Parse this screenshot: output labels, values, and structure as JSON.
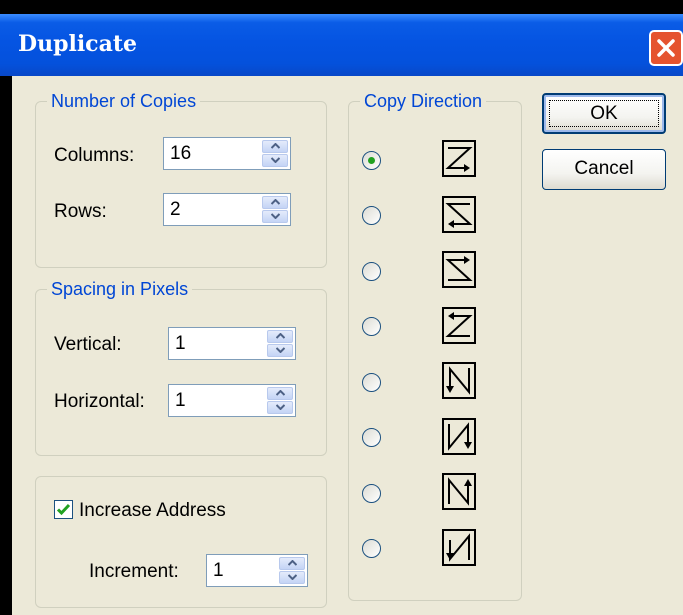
{
  "window": {
    "title": "Duplicate"
  },
  "copies": {
    "legend": "Number of Copies",
    "columns_label": "Columns:",
    "columns_value": "16",
    "rows_label": "Rows:",
    "rows_value": "2"
  },
  "spacing": {
    "legend": "Spacing in Pixels",
    "vertical_label": "Vertical:",
    "vertical_value": "1",
    "horizontal_label": "Horizontal:",
    "horizontal_value": "1"
  },
  "address": {
    "checkbox_label": "Increase Address",
    "checked": true,
    "increment_label": "Increment:",
    "increment_value": "1"
  },
  "direction": {
    "legend": "Copy Direction",
    "selected_index": 0,
    "options": [
      "row-major-left-right-top-down",
      "row-major-right-left-top-down",
      "row-major-left-right-bottom-up",
      "row-major-right-left-bottom-up",
      "column-major-top-down-right-left",
      "column-major-top-down-left-right",
      "column-major-bottom-up-left-right",
      "column-major-top-down-left-right-alt"
    ]
  },
  "buttons": {
    "ok": "OK",
    "cancel": "Cancel"
  },
  "colors": {
    "title_bar": "#0554e2",
    "legend_text": "#0046d5",
    "dialog_bg": "#ece9d8",
    "close_button": "#e5532f",
    "check_mark": "#21a121"
  }
}
